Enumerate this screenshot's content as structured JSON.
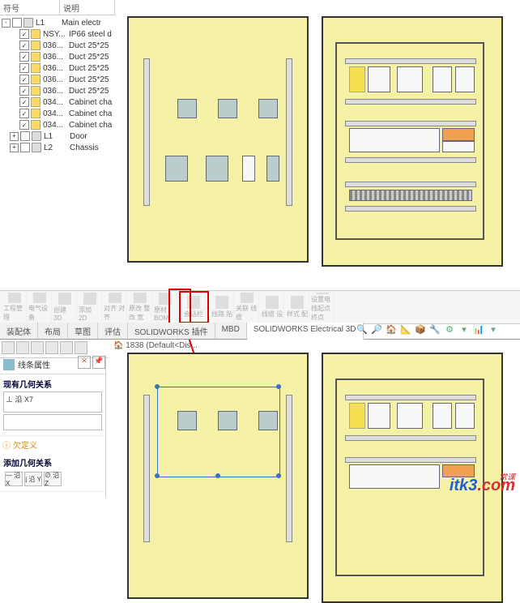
{
  "tree_header": {
    "col1": "符号",
    "col2": "说明"
  },
  "tree": [
    {
      "ind": 0,
      "exp": "-",
      "cb": false,
      "ico": "g",
      "c1": "L1",
      "c2": "Main electr"
    },
    {
      "ind": 22,
      "cb": true,
      "ico": "y",
      "c1": "NSY...",
      "c2": "IP66 steel d"
    },
    {
      "ind": 22,
      "cb": true,
      "ico": "y",
      "c1": "036...",
      "c2": "Duct 25*25"
    },
    {
      "ind": 22,
      "cb": true,
      "ico": "y",
      "c1": "036...",
      "c2": "Duct 25*25"
    },
    {
      "ind": 22,
      "cb": true,
      "ico": "y",
      "c1": "036...",
      "c2": "Duct 25*25"
    },
    {
      "ind": 22,
      "cb": true,
      "ico": "y",
      "c1": "036...",
      "c2": "Duct 25*25"
    },
    {
      "ind": 22,
      "cb": true,
      "ico": "y",
      "c1": "036...",
      "c2": "Duct 25*25"
    },
    {
      "ind": 22,
      "cb": true,
      "ico": "y",
      "c1": "034...",
      "c2": "Cabinet cha"
    },
    {
      "ind": 22,
      "cb": true,
      "ico": "y",
      "c1": "034...",
      "c2": "Cabinet cha"
    },
    {
      "ind": 22,
      "cb": true,
      "ico": "y",
      "c1": "034...",
      "c2": "Cabinet cha"
    },
    {
      "ind": 10,
      "exp": "+",
      "cb": false,
      "ico": "g",
      "c1": "L1",
      "c2": "Door"
    },
    {
      "ind": 10,
      "exp": "+",
      "cb": false,
      "ico": "g",
      "c1": "L2",
      "c2": "Chassis"
    }
  ],
  "ribbon": [
    "工程管理",
    "电气设备",
    "创建 3D",
    "添加 2D",
    "对齐 对齐",
    "原改 整改 宽",
    "原材 BOM",
    "会话栏",
    "线路 贴",
    "关联 线缆",
    "线缆 设",
    "样式 配",
    "设置电线起点终点"
  ],
  "tabs": [
    "装配体",
    "布局",
    "草图",
    "评估",
    "SOLIDWORKS 插件",
    "MBD",
    "SOLIDWORKS Electrical 3D"
  ],
  "mini_tb": [
    "🔍",
    "🔎",
    "🏠",
    "📐",
    "📦",
    "🔧",
    "⚙",
    "▾",
    "📊",
    "▾"
  ],
  "doc_label": "🏠 1838 (Default<Dis...",
  "prop": {
    "title": "线条属性",
    "sec1_title": "现有几何关系",
    "rel1_label": "⊥ 沿 X7",
    "warn_text": "欠定义",
    "sec2_title": "添加几何关系",
    "rel_btns": [
      "— 沿 X",
      "| 沿 Y",
      "⊘ 沿 Z"
    ]
  },
  "logo": {
    "text1": "itk3",
    "text2": ".com",
    "tag": "常课"
  }
}
